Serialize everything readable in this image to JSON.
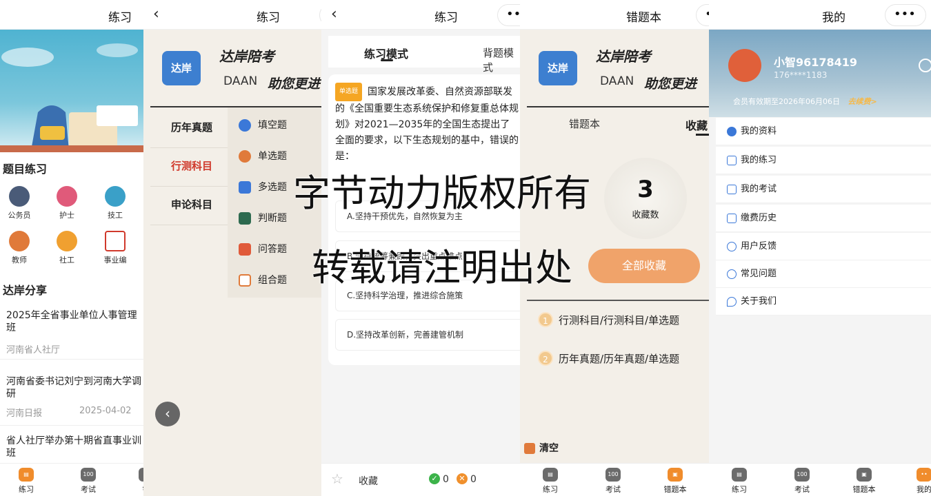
{
  "panel1": {
    "title": "练习",
    "section_practice": "题目练习",
    "categories": [
      {
        "label": "公务员",
        "icon": "civil-servant-icon",
        "color": "#4a5b78"
      },
      {
        "label": "护士",
        "icon": "nurse-icon",
        "color": "#e05a7a"
      },
      {
        "label": "技工",
        "icon": "worker-icon",
        "color": "#3aa0c8"
      },
      {
        "label": "教师",
        "icon": "teacher-icon",
        "color": "#e07a3a"
      },
      {
        "label": "社工",
        "icon": "social-worker-icon",
        "color": "#f0a030"
      },
      {
        "label": "事业编",
        "icon": "public-institution-icon",
        "color": "#d0392b"
      }
    ],
    "section_share": "达岸分享",
    "news": [
      {
        "title": "2025年全省事业单位人事管理班",
        "source": "河南省人社厅",
        "date": ""
      },
      {
        "title": "河南省委书记刘宁到河南大学调研",
        "source": "河南日报",
        "date": "2025-04-02"
      },
      {
        "title": "省人社厅举办第十期省直事业训班",
        "source": "",
        "date": ""
      }
    ],
    "tabs": [
      {
        "label": "练习",
        "glyph": "▤"
      },
      {
        "label": "考试",
        "glyph": "100"
      },
      {
        "label": "错",
        "glyph": "▤"
      }
    ]
  },
  "panel2": {
    "title": "练习",
    "logo_text": "达岸",
    "logo_sub": "DAAN",
    "brand": "达岸陪考",
    "daan": "DAAN",
    "slogan": "助您更进",
    "nav": [
      "历年真题",
      "行测科目",
      "申论科目"
    ],
    "types": [
      {
        "label": "填空题",
        "color": "#3b78d8"
      },
      {
        "label": "单选题",
        "color": "#e07a3a"
      },
      {
        "label": "多选题",
        "color": "#3b78d8"
      },
      {
        "label": "判断题",
        "color": "#2d6a4f"
      },
      {
        "label": "问答题",
        "color": "#e05a3a"
      },
      {
        "label": "组合题",
        "color": "#e07a3a"
      }
    ]
  },
  "panel3": {
    "title": "练习",
    "mode_practice": "练习模式",
    "mode_recite": "背题模式",
    "badge": "单选题",
    "question": "国家发展改革委、自然资源部联发的《全国重要生态系统保护和修复重总体规划》对2021—2035年的全国生态提出了全面的要求，以下生态规划的基中，错误的是：",
    "options": [
      "A.坚持干预优先，自然恢复为主",
      "B.坚持统筹兼顾，突出重点难点",
      "C.坚持科学治理，推进综合施策",
      "D.坚持改革创新，完善建管机制"
    ],
    "collect": "收藏",
    "correct_count": "0",
    "wrong_count": "0"
  },
  "panel4": {
    "title": "错题本",
    "logo_text": "达岸",
    "logo_sub": "DAAN",
    "brand": "达岸陪考",
    "daan": "DAAN",
    "slogan": "助您更进",
    "tab_wrong": "错题本",
    "tab_fav": "收藏",
    "count": "3",
    "count_label": "收藏数",
    "collect_all": "全部收藏",
    "list": [
      {
        "n": "1",
        "text": "行测科目/行测科目/单选题"
      },
      {
        "n": "2",
        "text": "历年真题/历年真题/单选题"
      }
    ],
    "clear": "清空",
    "tabs": [
      {
        "label": "练习",
        "glyph": "▤"
      },
      {
        "label": "考试",
        "glyph": "100"
      },
      {
        "label": "错题本",
        "glyph": "▣"
      }
    ]
  },
  "panel5": {
    "title": "我的",
    "username": "小智96178419",
    "phone": "176****1183",
    "member": "会员有效期至2026年06月06日",
    "renew": "去续费>",
    "menu": [
      {
        "label": "我的资料",
        "icon": "profile-icon"
      },
      {
        "label": "我的练习",
        "icon": "edit-icon"
      },
      {
        "label": "我的考试",
        "icon": "document-icon"
      },
      {
        "label": "缴费历史",
        "icon": "payment-icon"
      },
      {
        "label": "用户反馈",
        "icon": "feedback-icon"
      },
      {
        "label": "常见问题",
        "icon": "question-icon"
      },
      {
        "label": "关于我们",
        "icon": "heart-icon"
      }
    ],
    "tabs": [
      {
        "label": "练习",
        "glyph": "▤"
      },
      {
        "label": "考试",
        "glyph": "100"
      },
      {
        "label": "错题本",
        "glyph": "▣"
      },
      {
        "label": "我的",
        "glyph": "••"
      }
    ]
  },
  "watermark": {
    "line1": "字节动力版权所有",
    "line2": "转载请注明出处"
  }
}
